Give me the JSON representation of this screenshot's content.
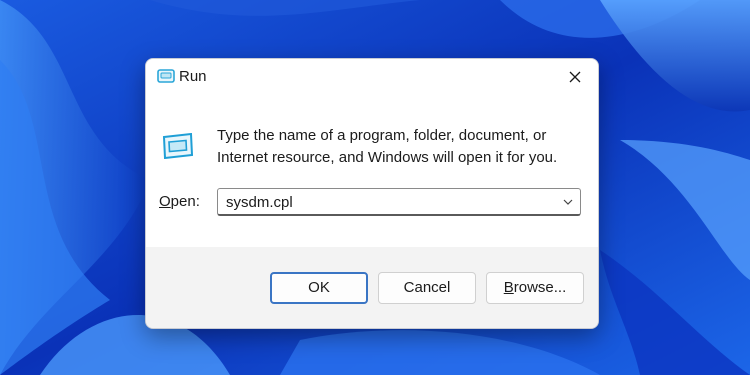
{
  "dialog": {
    "title": "Run",
    "description_line1": "Type the name of a program, folder, document, or",
    "description_line2": "Internet resource, and Windows will open it for you.",
    "open_label_mnemonic": "O",
    "open_label_rest": "pen:",
    "open_value": "sysdm.cpl",
    "buttons": {
      "ok": "OK",
      "cancel": "Cancel",
      "browse_mnemonic": "B",
      "browse_rest": "rowse..."
    }
  },
  "icons": {
    "title_icon": "run-icon",
    "close_icon": "close-icon",
    "app_icon": "run-icon",
    "dropdown_icon": "chevron-down-icon"
  },
  "colors": {
    "accent": "#3a75c4",
    "wallpaper_dark": "#0a2fb0",
    "wallpaper_light": "#3f8ef5"
  }
}
